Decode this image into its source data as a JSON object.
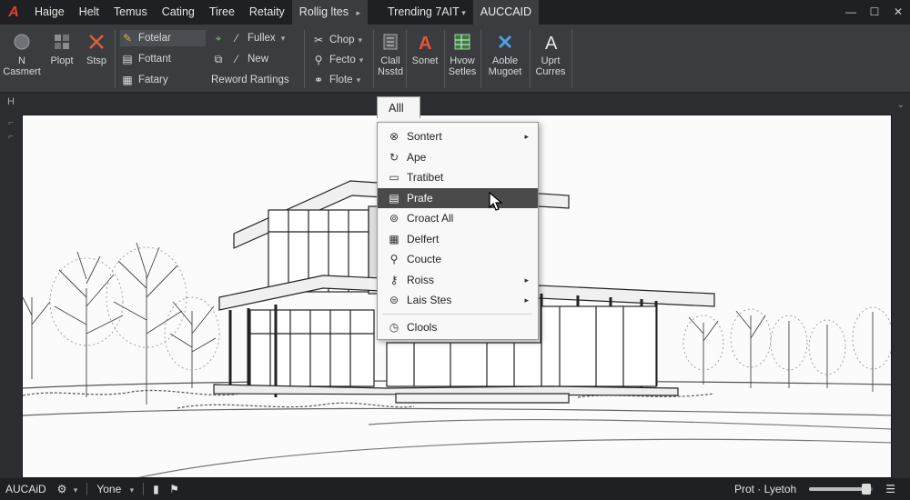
{
  "app": {
    "logo_glyph": "A"
  },
  "menu": {
    "items": [
      {
        "label": "Haige"
      },
      {
        "label": "Helt"
      },
      {
        "label": "Temus"
      },
      {
        "label": "Cating"
      },
      {
        "label": "Tiree"
      },
      {
        "label": "Retaity"
      },
      {
        "label": "Rollig ltes"
      },
      {
        "label": "Trending 7AIT"
      },
      {
        "label": "AUCCAID"
      }
    ]
  },
  "window_controls": {
    "minimize": "—",
    "maximize": "☐",
    "close": "✕"
  },
  "ribbon": {
    "big_buttons": [
      {
        "label": "N Casmert",
        "icon": "circle-icon"
      },
      {
        "label": "Plopt",
        "icon": "grid-icon"
      },
      {
        "label": "Stsp",
        "icon": "scissors-icon"
      },
      {
        "label": "Clall Nsstd",
        "icon": "list-icon"
      },
      {
        "label": "Sonet",
        "icon": "text-A-icon"
      },
      {
        "label": "Hvow Setles",
        "icon": "sheet-icon"
      },
      {
        "label": "Aoble Mugoet",
        "icon": "cross-icon"
      },
      {
        "label": "Uprt Curres",
        "icon": "letter-A-icon"
      }
    ],
    "col1": [
      "Fotelar",
      "Fottant",
      "Fatary"
    ],
    "col2": [
      "Fullex",
      "New",
      "Reword Rartings"
    ],
    "col3": [
      "Chop",
      "Fecto",
      "Flote"
    ]
  },
  "context_menu": {
    "tab_label": "Alll",
    "items": [
      {
        "label": "Sontert",
        "icon": "swirl-icon",
        "submenu": true,
        "active": false
      },
      {
        "label": "Ape",
        "icon": "refresh-icon",
        "submenu": false,
        "active": false
      },
      {
        "label": "Tratibet",
        "icon": "box-icon",
        "submenu": false,
        "active": false
      },
      {
        "label": "Prafe",
        "icon": "printer-icon",
        "submenu": false,
        "active": true
      },
      {
        "label": "Croact All",
        "icon": "link-icon",
        "submenu": false,
        "active": false
      },
      {
        "label": "Delfert",
        "icon": "calendar-icon",
        "submenu": false,
        "active": false
      },
      {
        "label": "Coucte",
        "icon": "magnifier-icon",
        "submenu": false,
        "active": false
      },
      {
        "label": "Roiss",
        "icon": "key-icon",
        "submenu": true,
        "active": false
      },
      {
        "label": "Lais Stes",
        "icon": "layers-icon",
        "submenu": true,
        "active": false
      },
      {
        "label": "Clools",
        "icon": "clock-icon",
        "submenu": false,
        "active": false
      }
    ]
  },
  "statusbar": {
    "app_label": "AUCAiD",
    "mode_label": "Yone",
    "right_label": "Prot · Lyetoh",
    "zoom_fraction": 0.9
  }
}
